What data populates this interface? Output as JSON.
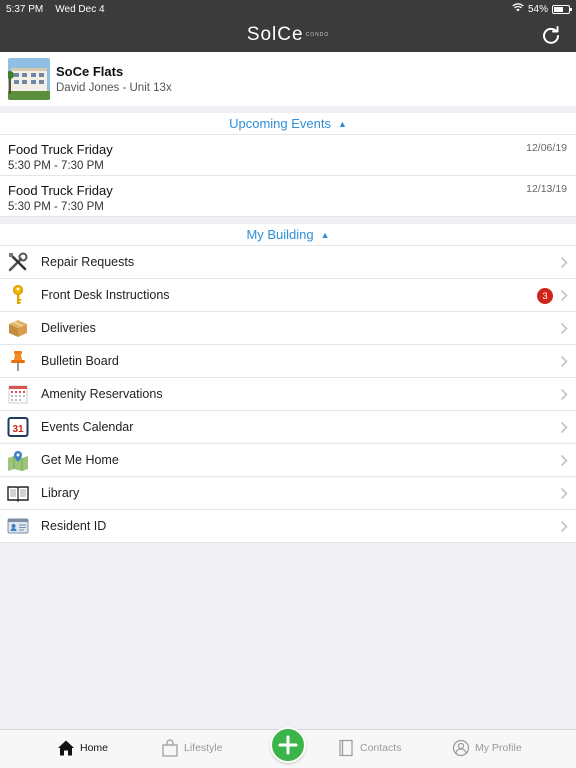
{
  "status_bar": {
    "time": "5:37 PM",
    "date": "Wed Dec 4",
    "battery": "54%",
    "battery_level": 0.54
  },
  "header": {
    "logo_text": "SolCe",
    "logo_sub": "CONDO"
  },
  "property": {
    "name": "SoCe Flats",
    "resident": "David Jones - Unit 13x"
  },
  "upcoming_events": {
    "title": "Upcoming Events",
    "items": [
      {
        "title": "Food Truck Friday",
        "time": "5:30 PM - 7:30 PM",
        "date": "12/06/19"
      },
      {
        "title": "Food Truck Friday",
        "time": "5:30 PM - 7:30 PM",
        "date": "12/13/19"
      }
    ]
  },
  "my_building": {
    "title": "My Building",
    "items": [
      {
        "label": "Repair Requests",
        "icon": "tools-icon",
        "badge": ""
      },
      {
        "label": "Front Desk Instructions",
        "icon": "key-icon",
        "badge": "3"
      },
      {
        "label": "Deliveries",
        "icon": "package-icon",
        "badge": ""
      },
      {
        "label": "Bulletin Board",
        "icon": "pushpin-icon",
        "badge": ""
      },
      {
        "label": "Amenity Reservations",
        "icon": "calendar-grid-icon",
        "badge": ""
      },
      {
        "label": "Events Calendar",
        "icon": "calendar-31-icon",
        "badge": ""
      },
      {
        "label": "Get Me Home",
        "icon": "map-pin-icon",
        "badge": ""
      },
      {
        "label": "Library",
        "icon": "book-icon",
        "badge": ""
      },
      {
        "label": "Resident ID",
        "icon": "id-card-icon",
        "badge": ""
      }
    ]
  },
  "tabbar": {
    "home": "Home",
    "lifestyle": "Lifestyle",
    "contacts": "Contacts",
    "profile": "My Profile"
  },
  "colors": {
    "accent": "#2e8fd8",
    "topbar": "#3b3b3b",
    "fab": "#3bb54a",
    "badge": "#d0241b"
  }
}
